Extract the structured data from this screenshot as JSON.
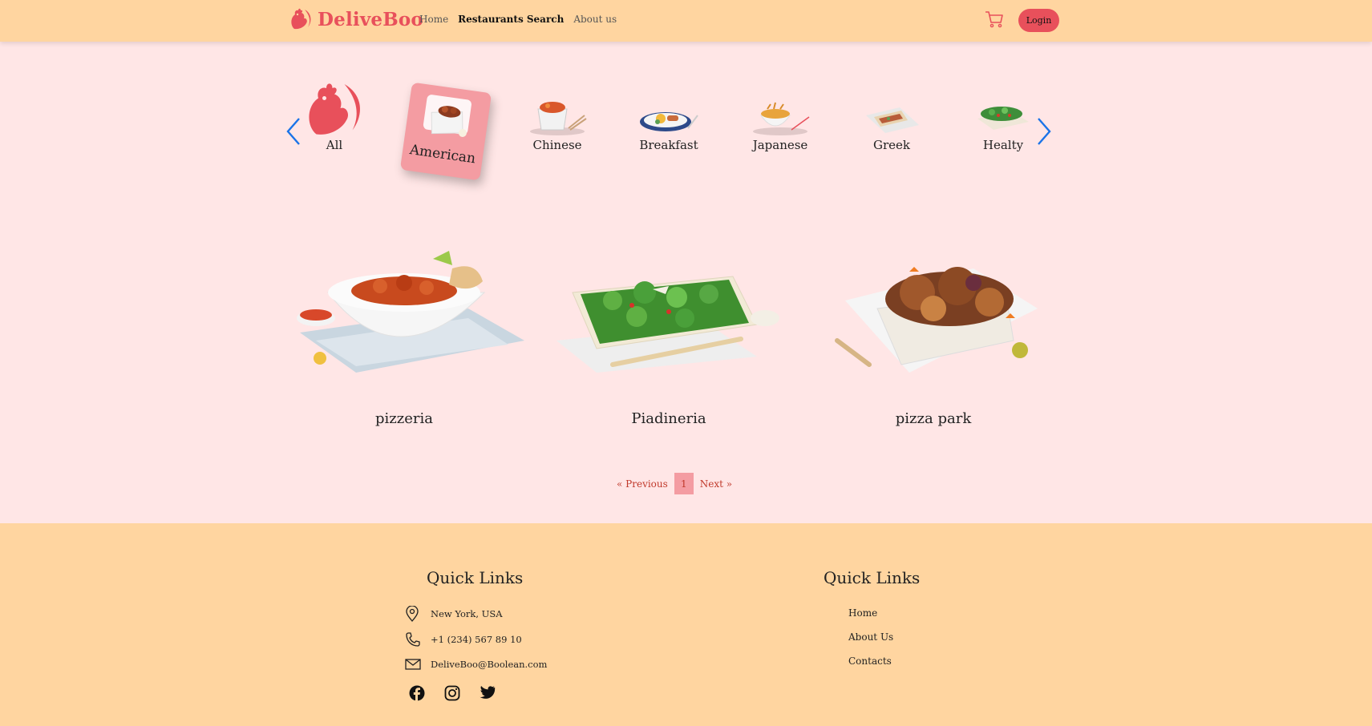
{
  "colors": {
    "header_bg": "#ffd5a0",
    "page_bg": "#ffe6e6",
    "accent": "#e8505b",
    "selected_card": "#f49ca2",
    "arrow": "#1a73e8"
  },
  "header": {
    "brand": "DeliveBoo",
    "nav": [
      {
        "label": "Home"
      },
      {
        "label": "Restaurants Search"
      },
      {
        "label": "About us"
      }
    ],
    "login_label": "Login"
  },
  "categories": [
    {
      "label": "All",
      "icon": "rooster-logo-icon"
    },
    {
      "label": "American",
      "icon": "american-food-icon",
      "selected": true
    },
    {
      "label": "Chinese",
      "icon": "chinese-food-icon"
    },
    {
      "label": "Breakfast",
      "icon": "breakfast-food-icon"
    },
    {
      "label": "Japanese",
      "icon": "japanese-food-icon"
    },
    {
      "label": "Greek",
      "icon": "greek-food-icon"
    },
    {
      "label": "Healty",
      "icon": "salad-food-icon"
    }
  ],
  "restaurants": [
    {
      "name": "pizzeria"
    },
    {
      "name": "Piadineria"
    },
    {
      "name": "pizza park"
    }
  ],
  "pagination": {
    "previous": "« Previous",
    "current": "1",
    "next": "Next »"
  },
  "footer": {
    "contact_title": "Quick Links",
    "address": "New York, USA",
    "phone": "+1 (234) 567 89 10",
    "email": "DeliveBoo@Boolean.com",
    "links_title": "Quick Links",
    "links": [
      {
        "label": "Home"
      },
      {
        "label": "About Us"
      },
      {
        "label": "Contacts"
      }
    ],
    "social": [
      "facebook-icon",
      "instagram-icon",
      "twitter-icon"
    ]
  }
}
